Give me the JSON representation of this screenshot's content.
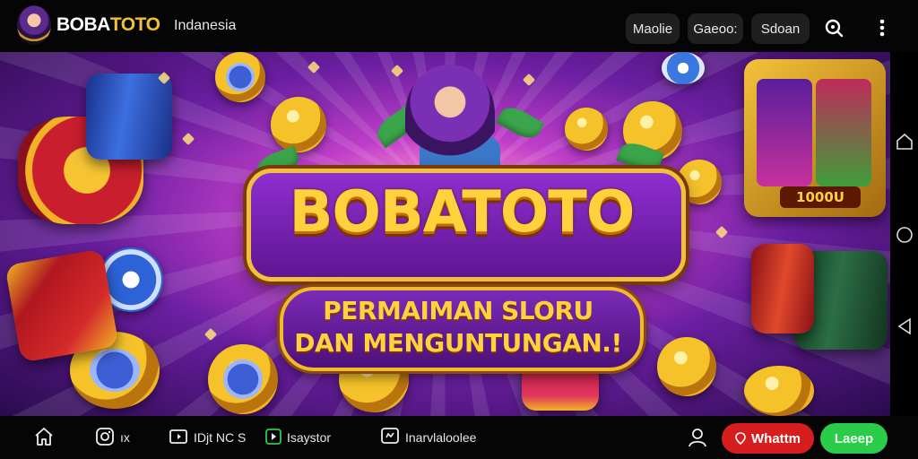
{
  "header": {
    "brand_prefix": "BOBA",
    "brand_suffix": "TOTO",
    "region": "Indanesia",
    "pills": [
      "Maolie",
      "Gaeoo:",
      "Sdoan"
    ],
    "icons": [
      "search-icon",
      "more-vertical-icon"
    ]
  },
  "hero": {
    "title": "BOBATOTO",
    "subtitle_line1": "PERMAIMAN SLORU",
    "subtitle_line2": "DAN MENGUNTUNGAN.!",
    "slot_badge": "1000U"
  },
  "system_rail": {
    "icons": [
      "home-outline-icon",
      "circle-icon",
      "back-triangle-icon"
    ]
  },
  "bottom_nav": {
    "items": [
      {
        "icon": "home-icon",
        "label": ""
      },
      {
        "icon": "instagram-icon",
        "label": "ıx"
      },
      {
        "icon": "video-icon",
        "label": "IDjt NC S"
      },
      {
        "icon": "play-square-icon",
        "label": "Isaystor"
      },
      {
        "icon": "chat-square-icon",
        "label": "Inarvlaloolee"
      }
    ],
    "profile_icon": "user-icon",
    "whatsapp_label": "Whattm",
    "login_label": "Laeep"
  },
  "colors": {
    "brand_gold": "#f2c12e",
    "whatsapp_red": "#d61e1e",
    "login_green": "#2bcc4a",
    "hero_purple": "#6a1ea0"
  }
}
